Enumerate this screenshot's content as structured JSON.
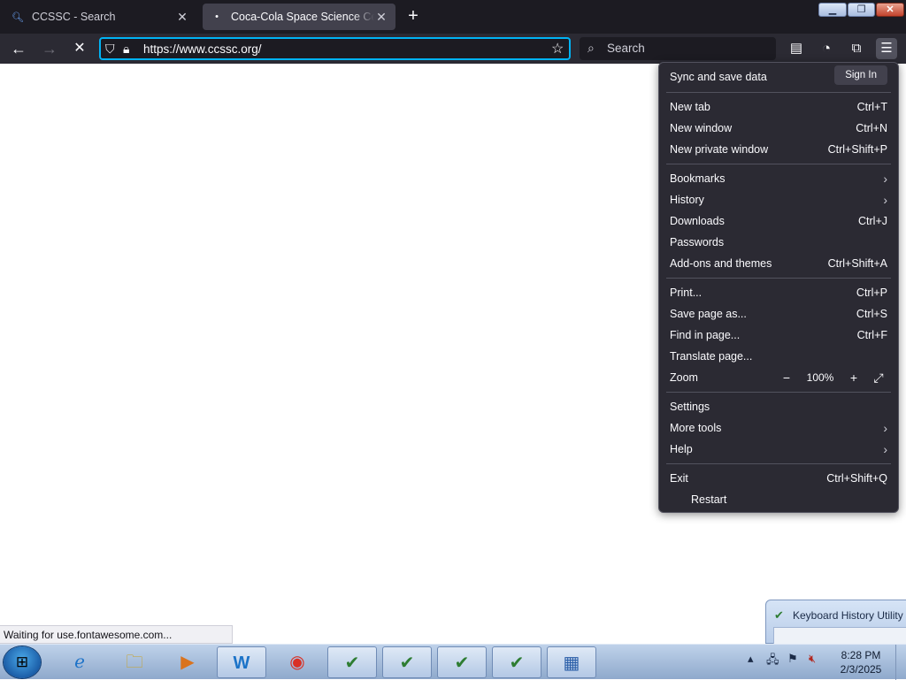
{
  "tabs": [
    {
      "title": "CCSSC - Search",
      "favicon": "search-icon",
      "active": false
    },
    {
      "title": "Coca-Cola Space Science Center",
      "favicon": "dot-icon",
      "active": true
    }
  ],
  "window_controls": {
    "min": "▭",
    "max": "❐",
    "close": "✕"
  },
  "toolbar": {
    "url": "https://www.ccssc.org/",
    "search_placeholder": "Search"
  },
  "status_text": "Waiting for use.fontawesome.com...",
  "app_menu": {
    "sync_label": "Sync and save data",
    "sign_in": "Sign In",
    "group1": [
      {
        "label": "New tab",
        "shortcut": "Ctrl+T"
      },
      {
        "label": "New window",
        "shortcut": "Ctrl+N"
      },
      {
        "label": "New private window",
        "shortcut": "Ctrl+Shift+P"
      }
    ],
    "group2": [
      {
        "label": "Bookmarks",
        "shortcut": "",
        "submenu": true
      },
      {
        "label": "History",
        "shortcut": "",
        "submenu": true
      },
      {
        "label": "Downloads",
        "shortcut": "Ctrl+J"
      },
      {
        "label": "Passwords",
        "shortcut": ""
      },
      {
        "label": "Add-ons and themes",
        "shortcut": "Ctrl+Shift+A"
      }
    ],
    "group3": [
      {
        "label": "Print...",
        "shortcut": "Ctrl+P"
      },
      {
        "label": "Save page as...",
        "shortcut": "Ctrl+S"
      },
      {
        "label": "Find in page...",
        "shortcut": "Ctrl+F"
      },
      {
        "label": "Translate page...",
        "shortcut": ""
      }
    ],
    "zoom": {
      "label": "Zoom",
      "value": "100%",
      "minus": "−",
      "plus": "+"
    },
    "group4": [
      {
        "label": "Settings",
        "shortcut": ""
      },
      {
        "label": "More tools",
        "shortcut": "",
        "submenu": true
      },
      {
        "label": "Help",
        "shortcut": "",
        "submenu": true
      }
    ],
    "exit": {
      "label": "Exit",
      "shortcut": "Ctrl+Shift+Q"
    },
    "restart": "Restart"
  },
  "background_window": {
    "title": "Keyboard History Utility"
  },
  "taskbar": {
    "apps": [
      "internet-explorer-icon",
      "file-explorer-icon",
      "media-player-icon",
      "word-app-icon",
      "chrome-icon",
      "task-icon-1",
      "task-icon-2",
      "task-icon-3",
      "task-icon-4",
      "control-panel-icon"
    ],
    "time": "8:28 PM",
    "date": "2/3/2025"
  },
  "colors": {
    "accent": "#00b3f4",
    "toolbar": "#2b2a33",
    "tabstrip": "#1c1b22"
  }
}
